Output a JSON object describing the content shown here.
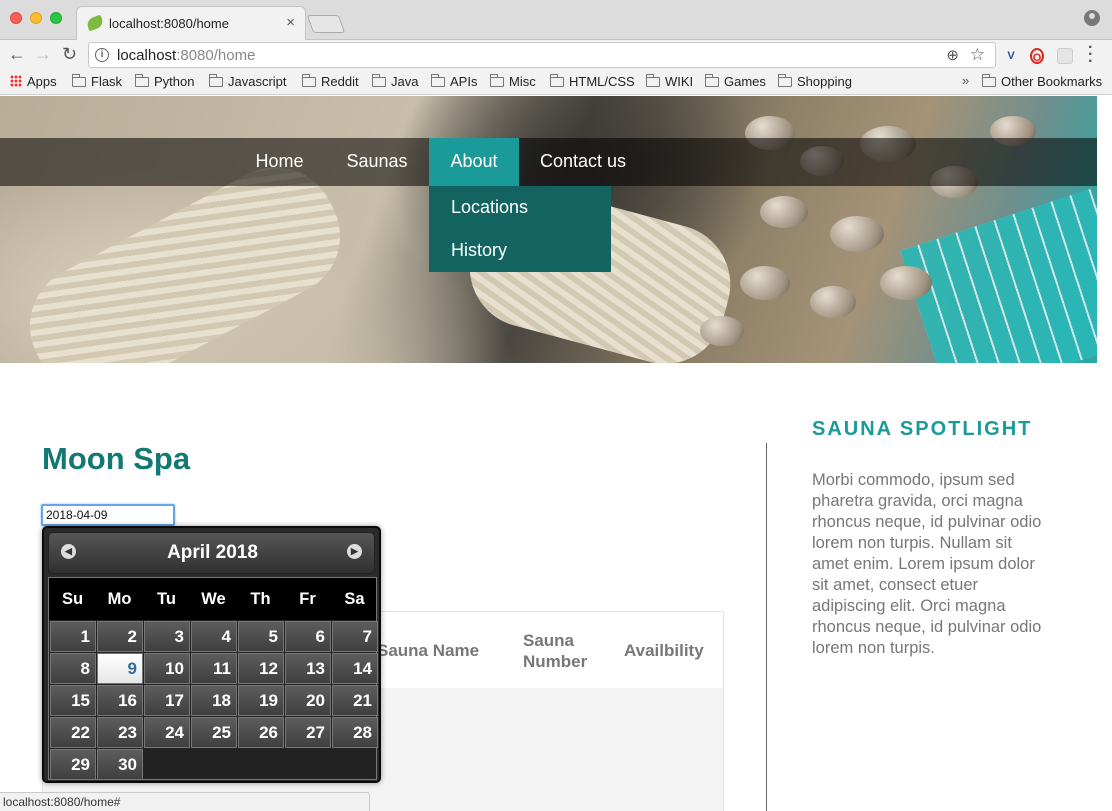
{
  "browser": {
    "tab_title": "localhost:8080/home",
    "tab_close": "×",
    "url_host": "localhost",
    "url_rest": ":8080/home",
    "nav_back": "←",
    "nav_forward": "→",
    "nav_reload": "↻",
    "info": "i",
    "zoom": "⊕",
    "star": "☆",
    "menu": "⋮",
    "extensions": [
      "V",
      "O",
      ""
    ],
    "bookmarks": [
      "Apps",
      "Flask",
      "Python",
      "Javascript",
      "Reddit",
      "Java",
      "APIs",
      "Misc",
      "HTML/CSS",
      "WIKI",
      "Games",
      "Shopping"
    ],
    "bookmarks_more": "»",
    "other_bookmarks": "Other Bookmarks",
    "status_url": "localhost:8080/home#"
  },
  "nav": {
    "items": [
      "Home",
      "Saunas",
      "About",
      "Contact us"
    ],
    "active": "About",
    "dropdown": [
      "Locations",
      "History"
    ]
  },
  "main": {
    "title": "Moon Spa",
    "date_value": "2018-04-09",
    "table_headers": [
      "Sauna Name",
      "Sauna Number",
      "Availbility"
    ]
  },
  "sidebar": {
    "title": "SAUNA SPOTLIGHT",
    "text": "Morbi commodo, ipsum sed pharetra gravida, orci magna rhoncus neque, id pulvinar odio lorem non turpis. Nullam sit amet enim. Lorem ipsum dolor sit amet, consect etuer adipiscing elit. Orci magna rhoncus neque, id pulvinar odio lorem non turpis."
  },
  "datepicker": {
    "title": "April 2018",
    "prev": "◀",
    "next": "▶",
    "weekdays": [
      "Su",
      "Mo",
      "Tu",
      "We",
      "Th",
      "Fr",
      "Sa"
    ],
    "days": [
      "1",
      "2",
      "3",
      "4",
      "5",
      "6",
      "7",
      "8",
      "9",
      "10",
      "11",
      "12",
      "13",
      "14",
      "15",
      "16",
      "17",
      "18",
      "19",
      "20",
      "21",
      "22",
      "23",
      "24",
      "25",
      "26",
      "27",
      "28",
      "29",
      "30"
    ],
    "selected": "9"
  },
  "colors": {
    "accent_teal": "#1a9a98",
    "title_teal": "#127873",
    "dropdown_bg": "#136461"
  }
}
